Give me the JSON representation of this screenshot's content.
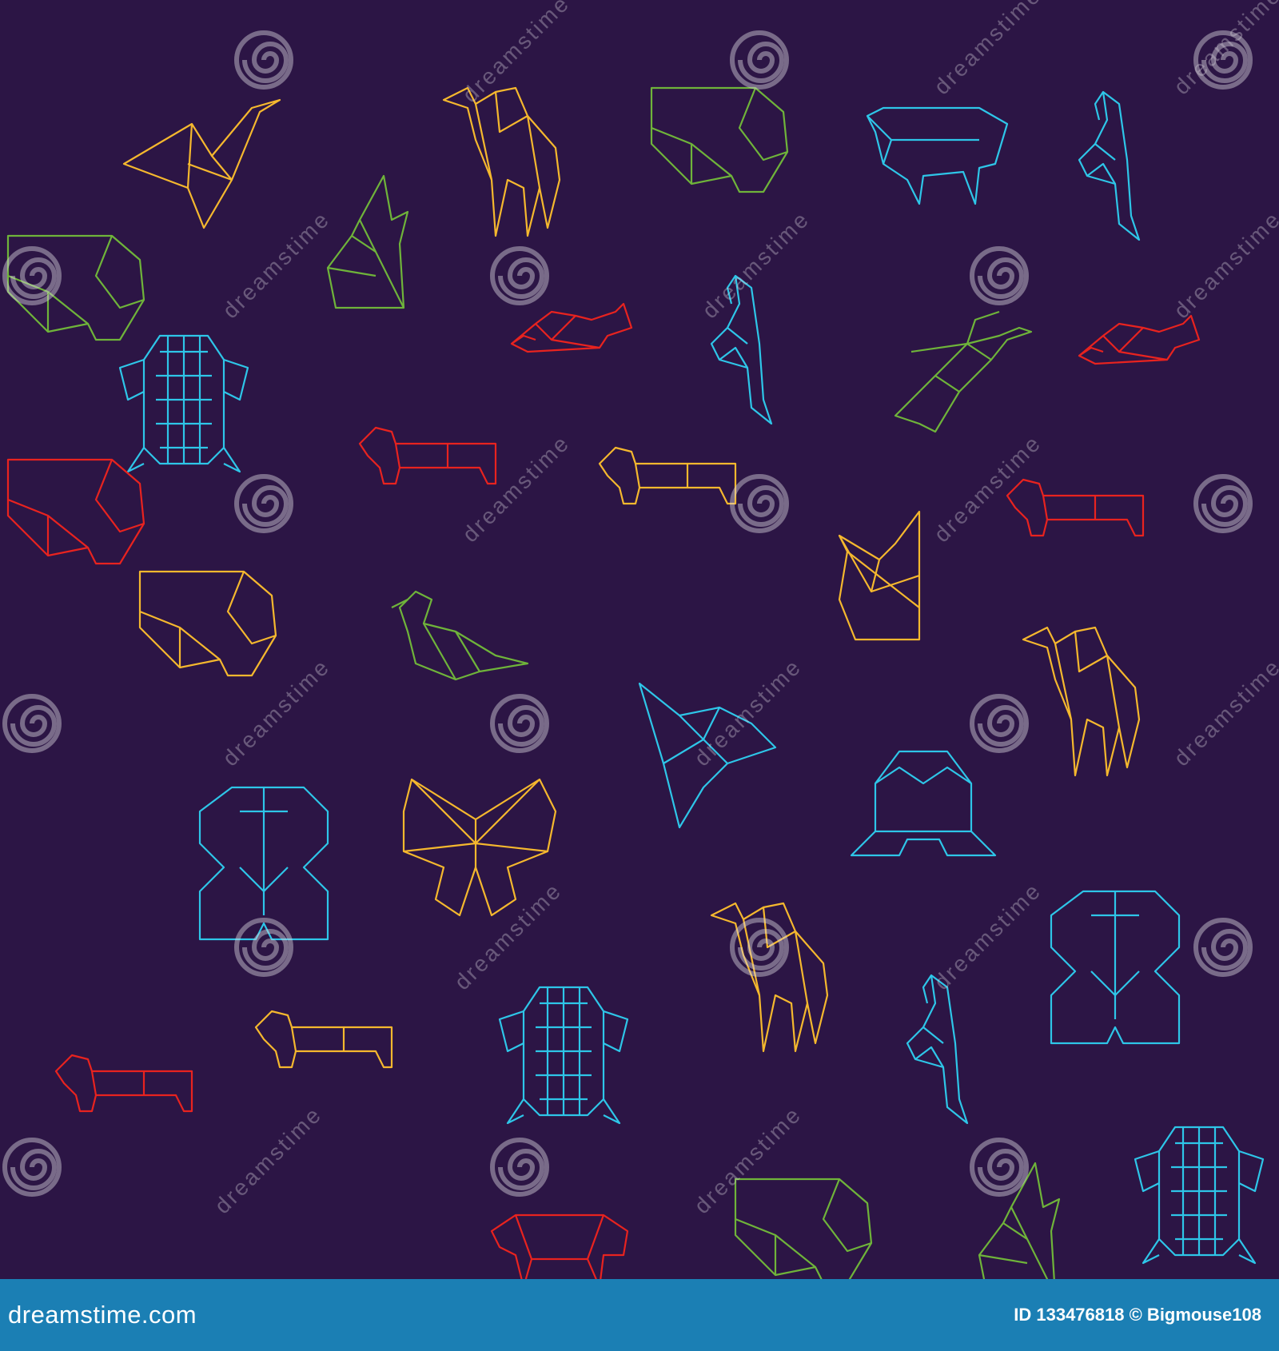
{
  "background_color": "#2c1545",
  "line_colors": [
    "#f5b82e",
    "#2ec6e8",
    "#e8231f",
    "#6fb43a"
  ],
  "watermark_text": "dreamstime",
  "figures": [
    {
      "kind": "bird",
      "color": "#f5b82e"
    },
    {
      "kind": "camel",
      "color": "#f5b82e"
    },
    {
      "kind": "elephant",
      "color": "#6fb43a"
    },
    {
      "kind": "sheep",
      "color": "#2ec6e8"
    },
    {
      "kind": "flamingo",
      "color": "#2ec6e8"
    },
    {
      "kind": "rabbit",
      "color": "#6fb43a"
    },
    {
      "kind": "turtle",
      "color": "#2ec6e8"
    },
    {
      "kind": "mouse",
      "color": "#e8231f"
    },
    {
      "kind": "flamingo",
      "color": "#2ec6e8"
    },
    {
      "kind": "hummingbird",
      "color": "#6fb43a"
    },
    {
      "kind": "mouse",
      "color": "#e8231f"
    },
    {
      "kind": "dog",
      "color": "#e8231f"
    },
    {
      "kind": "dog",
      "color": "#f5b82e"
    },
    {
      "kind": "fox",
      "color": "#f5b82e"
    },
    {
      "kind": "dog",
      "color": "#e8231f"
    },
    {
      "kind": "elephant",
      "color": "#f5b82e"
    },
    {
      "kind": "duck",
      "color": "#6fb43a"
    },
    {
      "kind": "fish",
      "color": "#2ec6e8"
    },
    {
      "kind": "camel",
      "color": "#f5b82e"
    },
    {
      "kind": "gorilla",
      "color": "#2ec6e8"
    },
    {
      "kind": "butterfly",
      "color": "#f5b82e"
    },
    {
      "kind": "frog",
      "color": "#2ec6e8"
    },
    {
      "kind": "camel",
      "color": "#f5b82e"
    },
    {
      "kind": "gorilla",
      "color": "#2ec6e8"
    },
    {
      "kind": "dog",
      "color": "#e8231f"
    },
    {
      "kind": "dog",
      "color": "#f5b82e"
    },
    {
      "kind": "turtle",
      "color": "#2ec6e8"
    },
    {
      "kind": "flamingo",
      "color": "#2ec6e8"
    },
    {
      "kind": "turtle",
      "color": "#2ec6e8"
    },
    {
      "kind": "elephant",
      "color": "#6fb43a"
    },
    {
      "kind": "rabbit",
      "color": "#6fb43a"
    },
    {
      "kind": "cow",
      "color": "#e8231f"
    },
    {
      "kind": "elephant",
      "color": "#6fb43a"
    },
    {
      "kind": "elephant",
      "color": "#e8231f"
    }
  ],
  "footer": {
    "brand": "dreamstime.com",
    "id_text": "ID 133476818",
    "credit": "© Bigmouse108",
    "color": "#1b7fb4"
  }
}
